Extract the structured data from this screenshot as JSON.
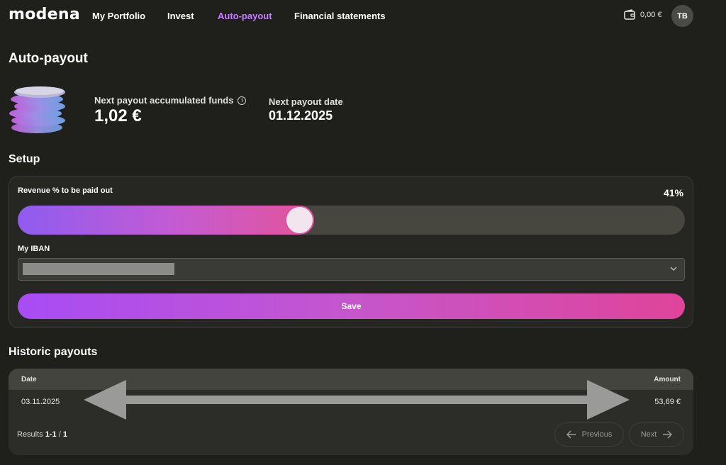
{
  "nav": {
    "logo": "modena",
    "links": [
      "My Portfolio",
      "Invest",
      "Auto-payout",
      "Financial statements"
    ],
    "active": "Auto-payout",
    "balance": "0,00 €",
    "avatar": "TB"
  },
  "page": {
    "title": "Auto-payout"
  },
  "summary": {
    "accumulated_label": "Next payout accumulated funds",
    "accumulated_value": "1,02 €",
    "date_label": "Next payout date",
    "date_value": "01.12.2025"
  },
  "setup": {
    "title": "Setup",
    "revenue_label": "Revenue % to be paid out",
    "revenue_value": "41%",
    "revenue_percent": 41,
    "iban_label": "My IBAN",
    "save_label": "Save"
  },
  "history": {
    "title": "Historic payouts",
    "columns": [
      "Date",
      "Amount"
    ],
    "rows": [
      {
        "date": "03.11.2025",
        "amount": "53,69 €"
      }
    ],
    "results_prefix": "Results",
    "results_range": "1-1",
    "results_total": "1",
    "previous_label": "Previous",
    "next_label": "Next"
  },
  "icons": [
    "wallet-icon",
    "info-icon",
    "coins-stack-icon",
    "chevron-down-icon",
    "arrow-left-icon",
    "arrow-right-icon",
    "double-arrow-overlay"
  ],
  "colors": {
    "accent": "#c77dff",
    "background": "#1f1f1c",
    "gradient_start": "#a84cf4",
    "gradient_end": "#e0449a"
  }
}
